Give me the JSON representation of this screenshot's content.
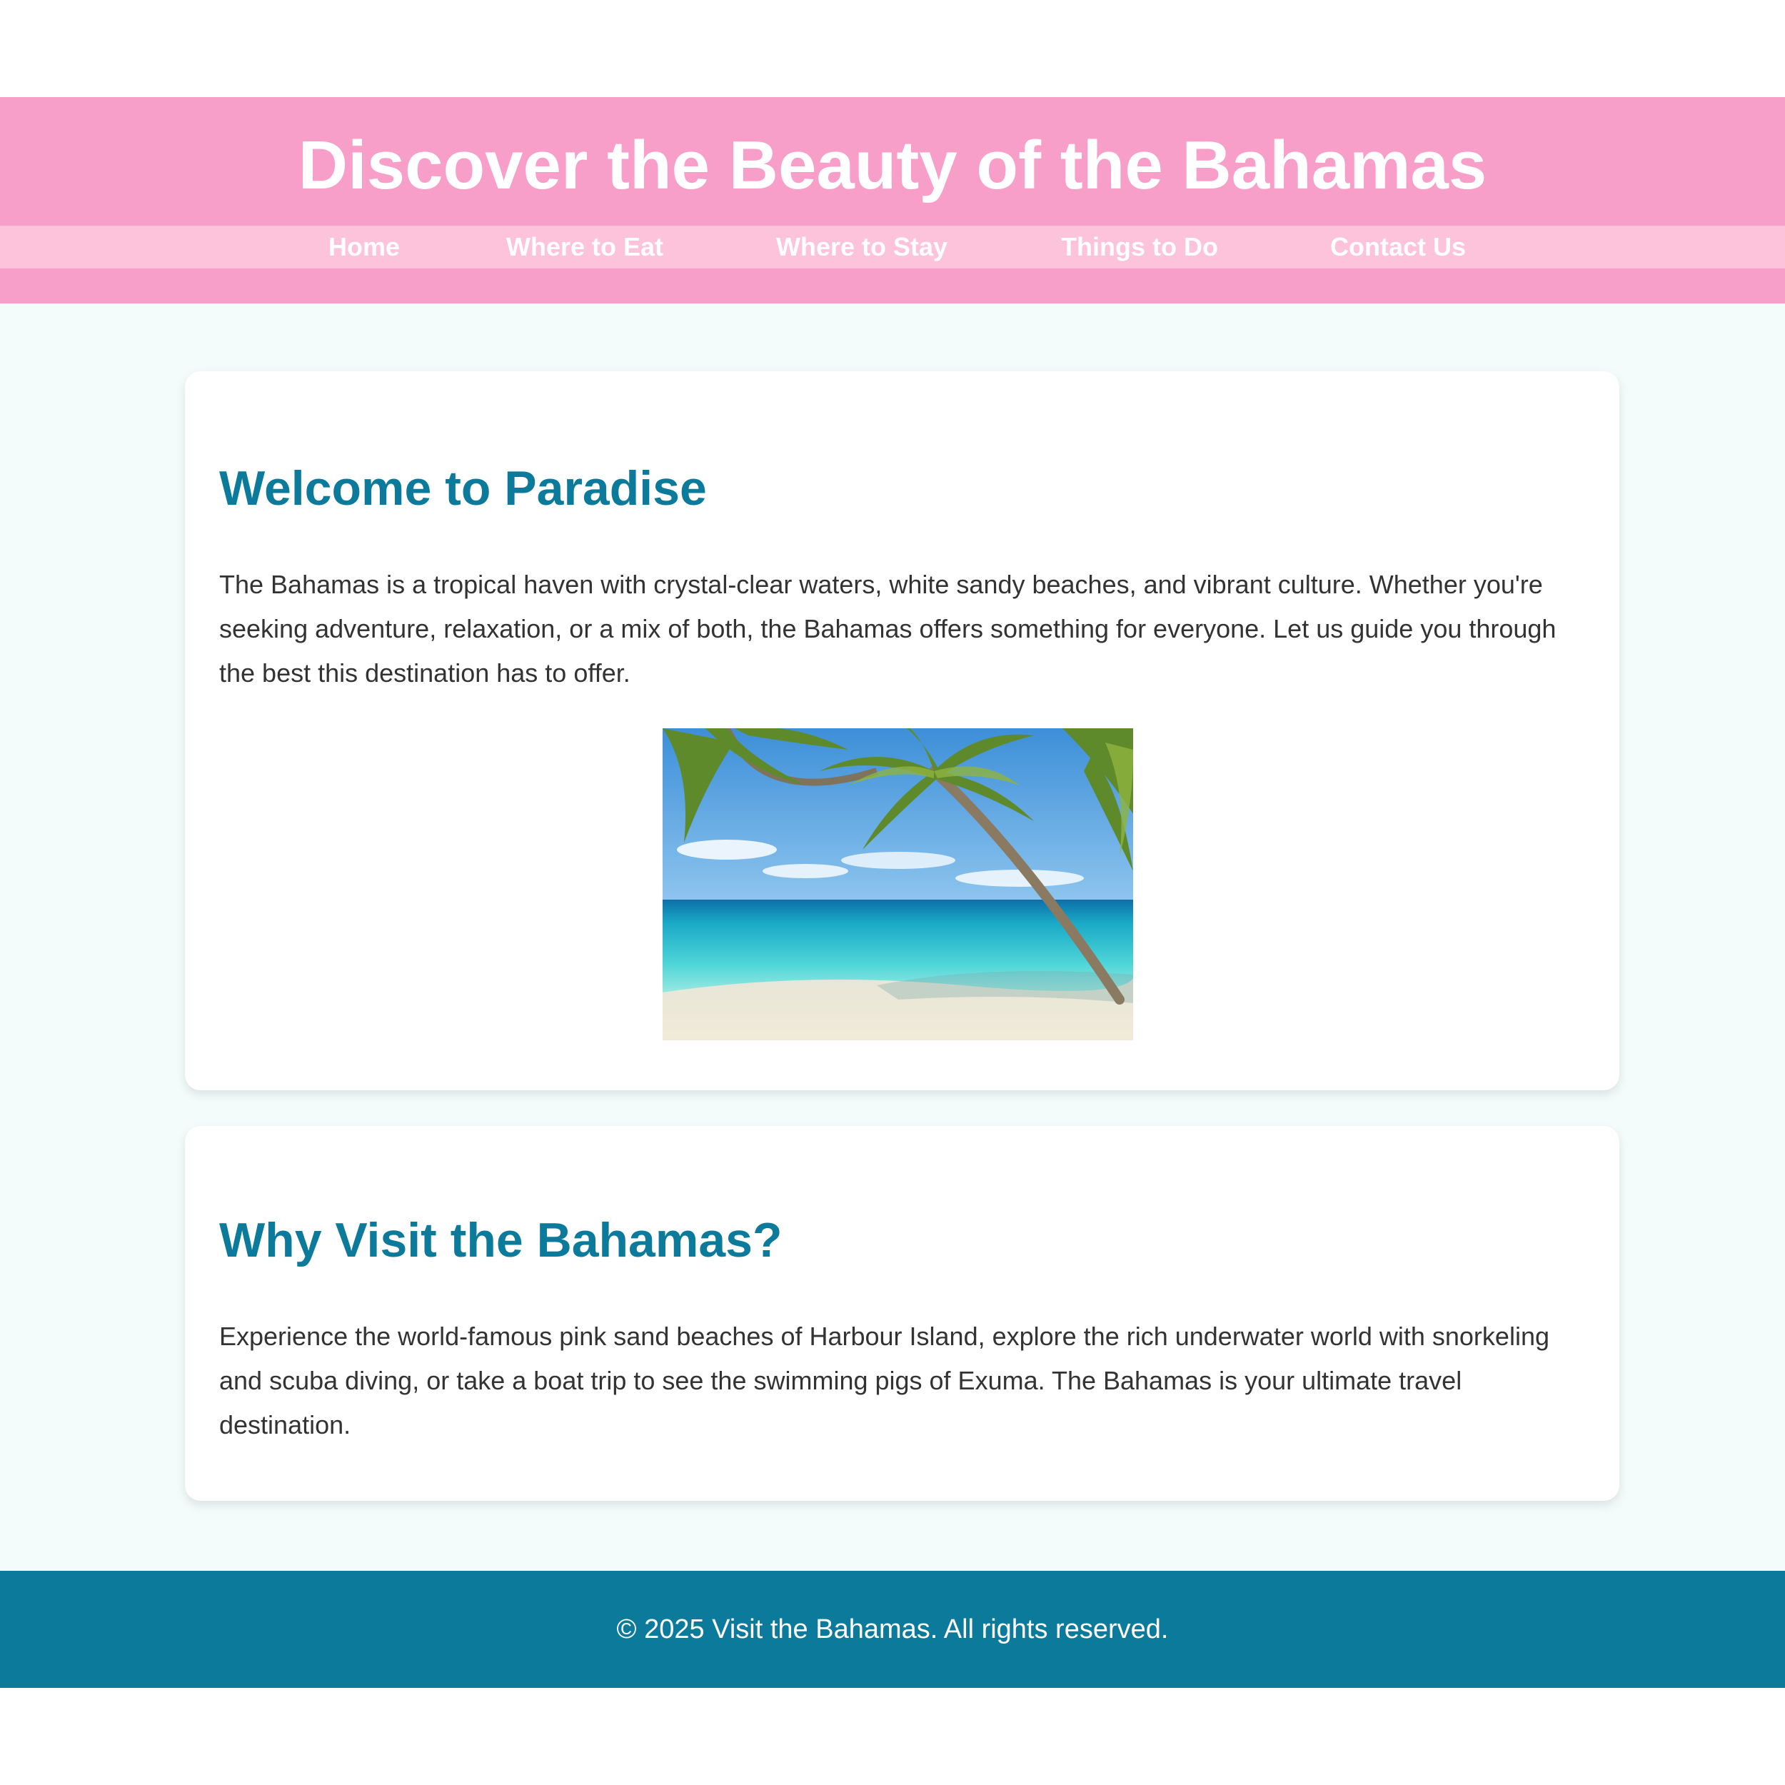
{
  "header": {
    "title": "Discover the Beauty of the Bahamas",
    "nav": [
      {
        "label": "Home"
      },
      {
        "label": "Where to Eat"
      },
      {
        "label": "Where to Stay"
      },
      {
        "label": "Things to Do"
      },
      {
        "label": "Contact Us"
      }
    ]
  },
  "sections": [
    {
      "heading": "Welcome to Paradise",
      "text": "The Bahamas is a tropical haven with crystal-clear waters, white sandy beaches, and vibrant culture. Whether you're seeking adventure, relaxation, or a mix of both, the Bahamas offers something for everyone. Let us guide you through the best this destination has to offer.",
      "image": "tropical beach with leaning palm trees and turquoise sea"
    },
    {
      "heading": "Why Visit the Bahamas?",
      "text": "Experience the world-famous pink sand beaches of Harbour Island, explore the rich underwater world with snorkeling and scuba diving, or take a boat trip to see the swimming pigs of Exuma. The Bahamas is your ultimate travel destination."
    }
  ],
  "footer": {
    "text": "© 2025 Visit the Bahamas. All rights reserved."
  },
  "colors": {
    "header_pink": "#f79fc8",
    "nav_pink": "#fcc3da",
    "accent_teal": "#0c7a9b",
    "page_bg": "#f3fbfb"
  }
}
